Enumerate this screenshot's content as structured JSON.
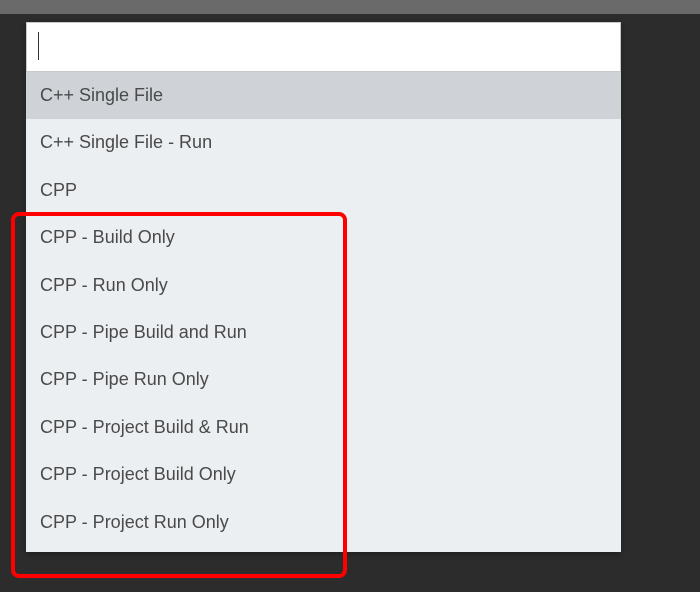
{
  "search": {
    "value": "",
    "placeholder": ""
  },
  "options": [
    {
      "label": "C++ Single File",
      "selected": true
    },
    {
      "label": "C++ Single File - Run",
      "selected": false
    },
    {
      "label": "CPP",
      "selected": false
    },
    {
      "label": "CPP - Build Only",
      "selected": false
    },
    {
      "label": "CPP - Run Only",
      "selected": false
    },
    {
      "label": "CPP - Pipe Build and Run",
      "selected": false
    },
    {
      "label": "CPP - Pipe Run Only",
      "selected": false
    },
    {
      "label": "CPP - Project Build & Run",
      "selected": false
    },
    {
      "label": "CPP - Project Build Only",
      "selected": false
    },
    {
      "label": "CPP - Project Run Only",
      "selected": false
    }
  ],
  "annotation": {
    "highlight_color": "#ff0000"
  }
}
